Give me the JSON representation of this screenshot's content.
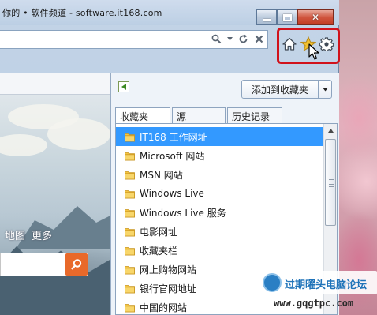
{
  "window": {
    "title": "你的 • 软件频道 - software.it168.com"
  },
  "addressbar": {
    "icons": [
      "search-icon",
      "chevron-down-icon",
      "refresh-icon",
      "close-icon"
    ]
  },
  "toolbar": {
    "icons": [
      "home-icon",
      "star-icon",
      "gear-icon"
    ],
    "highlight_color": "#d1121b"
  },
  "page": {
    "nav_links": [
      "地图",
      "更多"
    ]
  },
  "favorites": {
    "add_button_label": "添加到收藏夹",
    "tabs": [
      "收藏夹",
      "源",
      "历史记录"
    ],
    "active_tab": "收藏夹",
    "items": [
      "IT168 工作网址",
      "Microsoft 网站",
      "MSN 网站",
      "Windows Live",
      "Windows Live 服务",
      "电影网址",
      "收藏夹栏",
      "网上购物网站",
      "银行官网地址",
      "中国的网站"
    ],
    "selected_index": 0,
    "selection_color": "#3399ff"
  },
  "watermark": {
    "text": "过期曜头电脑论坛",
    "url": "www.gqgtpc.com"
  }
}
